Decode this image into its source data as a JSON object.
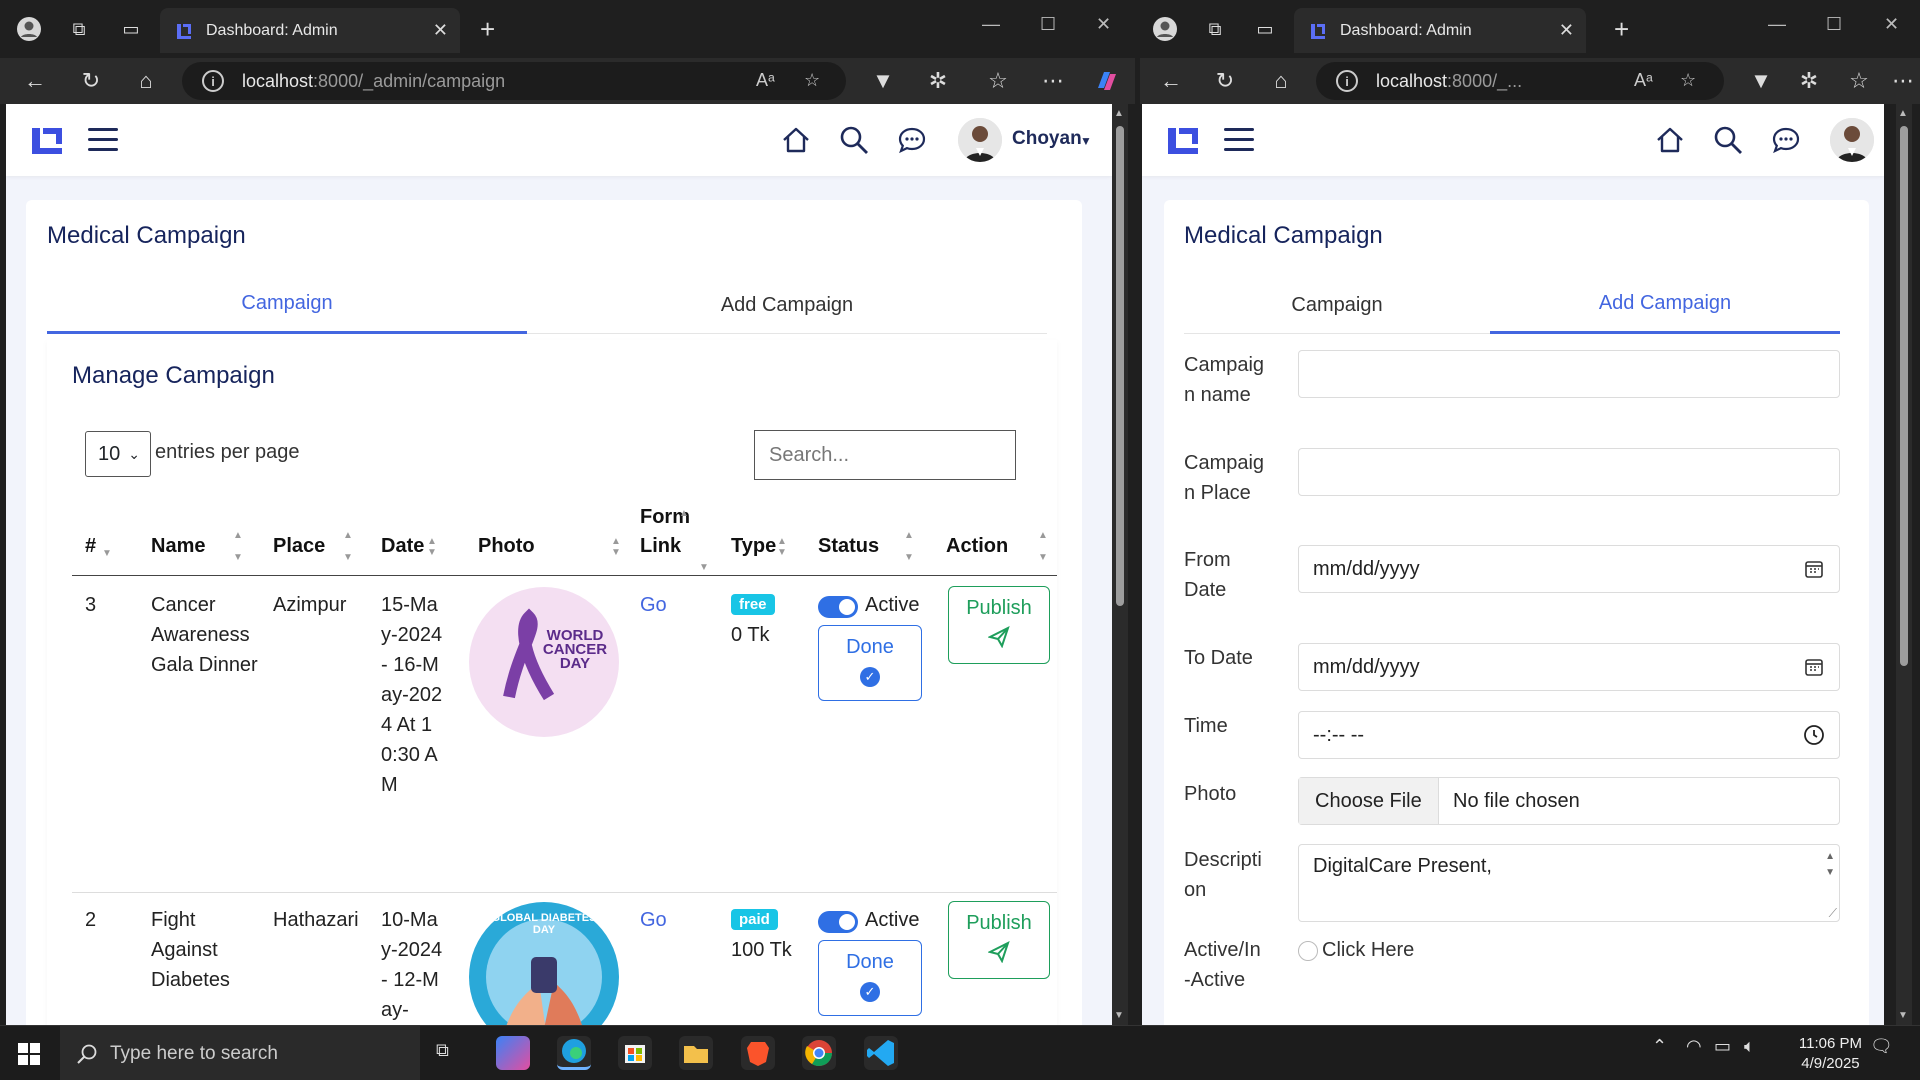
{
  "left_browser": {
    "tab_title": "Dashboard: Admin",
    "url_host": "localhost",
    "url_path": ":8000/_admin/campaign"
  },
  "right_browser": {
    "tab_title": "Dashboard: Admin",
    "url_host": "localhost",
    "url_path": ":8000/_..."
  },
  "app": {
    "user_name": "Choyan",
    "page_title": "Medical Campaign",
    "tabs": [
      {
        "label": "Campaign"
      },
      {
        "label": "Add Campaign"
      }
    ]
  },
  "manage": {
    "title": "Manage Campaign",
    "entries_value": "10",
    "entries_label": "entries per page",
    "search_placeholder": "Search...",
    "columns": [
      "#",
      "Name",
      "Place",
      "Date",
      "Photo",
      "Form Link",
      "Type",
      "Status",
      "Action"
    ],
    "rows": [
      {
        "num": "3",
        "name": "Cancer Awareness Gala Dinner",
        "place": "Azimpur",
        "date": "15-May-2024 - 16-May-2024 At 10:30 AM",
        "link": "Go",
        "type_badge": "free",
        "price": "0 Tk",
        "status": "Active",
        "done": "Done",
        "action": "Publish",
        "photo_text": "WORLD CANCER DAY"
      },
      {
        "num": "2",
        "name": "Fight Against Diabetes",
        "place": "Hathazari",
        "date": "10-May-2024 - 12-May-",
        "link": "Go",
        "type_badge": "paid",
        "price": "100 Tk",
        "status": "Active",
        "done": "Done",
        "action": "Publish",
        "photo_text": "GLOBAL DIABETES DAY"
      }
    ]
  },
  "form": {
    "campaign_name_label": "Campaig n name",
    "campaign_place_label": "Campaig n Place",
    "from_date_label": "From Date",
    "to_date_label": "To Date",
    "time_label": "Time",
    "photo_label": "Photo",
    "description_label": "Descripti on",
    "active_label": "Active/In -Active",
    "date_placeholder": "mm/dd/yyyy",
    "time_placeholder": "--:-- --",
    "choose_file": "Choose File",
    "no_file": "No file chosen",
    "description_value": "DigitalCare Present,",
    "click_here": "Click Here"
  },
  "taskbar": {
    "search_placeholder": "Type here to search",
    "time": "11:06 PM",
    "date": "4/9/2025"
  },
  "colors": {
    "accent": "#4366e0",
    "title": "#16245c",
    "publish_green": "#1e9e5b",
    "badge": "#18c5e6"
  }
}
